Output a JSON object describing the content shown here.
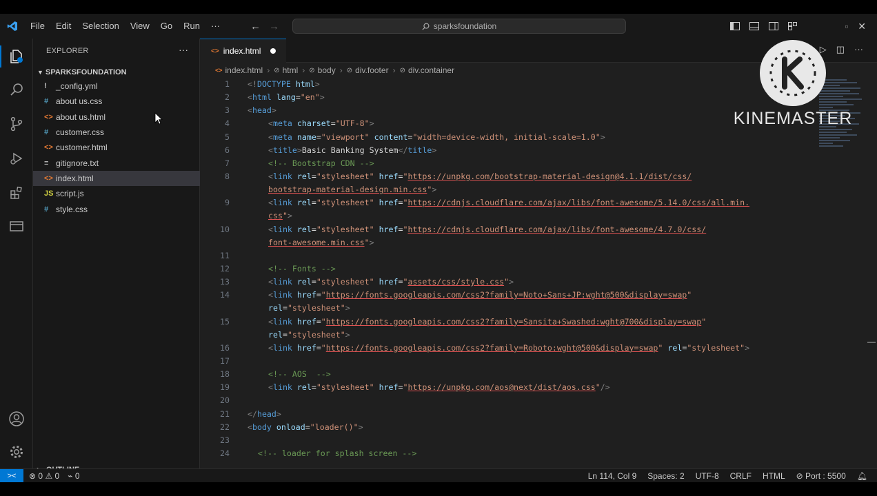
{
  "menu": [
    "File",
    "Edit",
    "Selection",
    "View",
    "Go",
    "Run",
    "···"
  ],
  "search": {
    "text": "sparksfoundation"
  },
  "sidebar": {
    "title": "EXPLORER",
    "more": "···",
    "folder": "SPARKSFOUNDATION",
    "files": [
      {
        "icon": "!",
        "name": "_config.yml",
        "color": "#c5c5c5"
      },
      {
        "icon": "#",
        "name": "about us.css",
        "color": "#519aba"
      },
      {
        "icon": "<>",
        "name": "about us.html",
        "color": "#e37933"
      },
      {
        "icon": "#",
        "name": "customer.css",
        "color": "#519aba"
      },
      {
        "icon": "<>",
        "name": "customer.html",
        "color": "#e37933"
      },
      {
        "icon": "≡",
        "name": "gitignore.txt",
        "color": "#c5c5c5"
      },
      {
        "icon": "<>",
        "name": "index.html",
        "color": "#e37933"
      },
      {
        "icon": "JS",
        "name": "script.js",
        "color": "#cbcb41"
      },
      {
        "icon": "#",
        "name": "style.css",
        "color": "#519aba"
      }
    ],
    "outline": "OUTLINE"
  },
  "tab": {
    "name": "index.html"
  },
  "breadcrumbs": [
    "index.html",
    "html",
    "body",
    "div.footer",
    "div.container"
  ],
  "code_lines": [
    {
      "n": "1",
      "i": 0,
      "s": [
        [
          "t",
          "<!"
        ],
        [
          "tn",
          "DOCTYPE"
        ],
        [
          "tx",
          " "
        ],
        [
          "an",
          "html"
        ],
        [
          "t",
          ">"
        ]
      ]
    },
    {
      "n": "2",
      "i": 0,
      "s": [
        [
          "t",
          "<"
        ],
        [
          "tn",
          "html"
        ],
        [
          "tx",
          " "
        ],
        [
          "an",
          "lang"
        ],
        [
          "tx",
          "="
        ],
        [
          "av",
          "\"en\""
        ],
        [
          "t",
          ">"
        ]
      ]
    },
    {
      "n": "3",
      "i": 0,
      "s": [
        [
          "t",
          "<"
        ],
        [
          "tn",
          "head"
        ],
        [
          "t",
          ">"
        ]
      ]
    },
    {
      "n": "4",
      "i": 2,
      "s": [
        [
          "t",
          "<"
        ],
        [
          "tn",
          "meta"
        ],
        [
          "tx",
          " "
        ],
        [
          "an",
          "charset"
        ],
        [
          "tx",
          "="
        ],
        [
          "av",
          "\"UTF-8\""
        ],
        [
          "t",
          ">"
        ]
      ]
    },
    {
      "n": "5",
      "i": 2,
      "s": [
        [
          "t",
          "<"
        ],
        [
          "tn",
          "meta"
        ],
        [
          "tx",
          " "
        ],
        [
          "an",
          "name"
        ],
        [
          "tx",
          "="
        ],
        [
          "av",
          "\"viewport\""
        ],
        [
          "tx",
          " "
        ],
        [
          "an",
          "content"
        ],
        [
          "tx",
          "="
        ],
        [
          "av",
          "\"width=device-width, initial-scale=1.0\""
        ],
        [
          "t",
          ">"
        ]
      ]
    },
    {
      "n": "6",
      "i": 2,
      "s": [
        [
          "t",
          "<"
        ],
        [
          "tn",
          "title"
        ],
        [
          "t",
          ">"
        ],
        [
          "tx",
          "Basic Banking System"
        ],
        [
          "t",
          "</"
        ],
        [
          "tn",
          "title"
        ],
        [
          "t",
          ">"
        ]
      ]
    },
    {
      "n": "7",
      "i": 2,
      "s": [
        [
          "cm",
          "<!-- Bootstrap CDN -->"
        ]
      ]
    },
    {
      "n": "8",
      "i": 2,
      "s": [
        [
          "t",
          "<"
        ],
        [
          "tn",
          "link"
        ],
        [
          "tx",
          " "
        ],
        [
          "an",
          "rel"
        ],
        [
          "tx",
          "="
        ],
        [
          "av",
          "\"stylesheet\""
        ],
        [
          "tx",
          " "
        ],
        [
          "an",
          "href"
        ],
        [
          "tx",
          "="
        ],
        [
          "av",
          "\""
        ],
        [
          "lnk",
          "https://unpkg.com/bootstrap-material-design@4.1.1/dist/css/"
        ]
      ]
    },
    {
      "n": "",
      "i": 2,
      "s": [
        [
          "lnk",
          "bootstrap-material-design.min.css"
        ],
        [
          "av",
          "\""
        ],
        [
          "t",
          ">"
        ]
      ]
    },
    {
      "n": "9",
      "i": 2,
      "s": [
        [
          "t",
          "<"
        ],
        [
          "tn",
          "link"
        ],
        [
          "tx",
          " "
        ],
        [
          "an",
          "rel"
        ],
        [
          "tx",
          "="
        ],
        [
          "av",
          "\"stylesheet\""
        ],
        [
          "tx",
          " "
        ],
        [
          "an",
          "href"
        ],
        [
          "tx",
          "="
        ],
        [
          "av",
          "\""
        ],
        [
          "lnk",
          "https://cdnjs.cloudflare.com/ajax/libs/font-awesome/5.14.0/css/all.min."
        ]
      ]
    },
    {
      "n": "",
      "i": 2,
      "s": [
        [
          "lnk",
          "css"
        ],
        [
          "av",
          "\""
        ],
        [
          "t",
          ">"
        ]
      ]
    },
    {
      "n": "10",
      "i": 2,
      "s": [
        [
          "t",
          "<"
        ],
        [
          "tn",
          "link"
        ],
        [
          "tx",
          " "
        ],
        [
          "an",
          "rel"
        ],
        [
          "tx",
          "="
        ],
        [
          "av",
          "\"stylesheet\""
        ],
        [
          "tx",
          " "
        ],
        [
          "an",
          "href"
        ],
        [
          "tx",
          "="
        ],
        [
          "av",
          "\""
        ],
        [
          "lnk",
          "https://cdnjs.cloudflare.com/ajax/libs/font-awesome/4.7.0/css/"
        ]
      ]
    },
    {
      "n": "",
      "i": 2,
      "s": [
        [
          "lnk",
          "font-awesome.min.css"
        ],
        [
          "av",
          "\""
        ],
        [
          "t",
          ">"
        ]
      ]
    },
    {
      "n": "11",
      "i": 0,
      "s": []
    },
    {
      "n": "12",
      "i": 2,
      "s": [
        [
          "cm",
          "<!-- Fonts -->"
        ]
      ]
    },
    {
      "n": "13",
      "i": 2,
      "s": [
        [
          "t",
          "<"
        ],
        [
          "tn",
          "link"
        ],
        [
          "tx",
          " "
        ],
        [
          "an",
          "rel"
        ],
        [
          "tx",
          "="
        ],
        [
          "av",
          "\"stylesheet\""
        ],
        [
          "tx",
          " "
        ],
        [
          "an",
          "href"
        ],
        [
          "tx",
          "="
        ],
        [
          "av",
          "\""
        ],
        [
          "lnk",
          "assets/css/style.css"
        ],
        [
          "av",
          "\""
        ],
        [
          "t",
          ">"
        ]
      ]
    },
    {
      "n": "14",
      "i": 2,
      "s": [
        [
          "t",
          "<"
        ],
        [
          "tn",
          "link"
        ],
        [
          "tx",
          " "
        ],
        [
          "an",
          "href"
        ],
        [
          "tx",
          "="
        ],
        [
          "av",
          "\""
        ],
        [
          "lnk",
          "https://fonts.googleapis.com/css2?family=Noto+Sans+JP:wght@500&display=swap"
        ],
        [
          "av",
          "\""
        ]
      ]
    },
    {
      "n": "",
      "i": 2,
      "s": [
        [
          "an",
          "rel"
        ],
        [
          "tx",
          "="
        ],
        [
          "av",
          "\"stylesheet\""
        ],
        [
          "t",
          ">"
        ]
      ]
    },
    {
      "n": "15",
      "i": 2,
      "s": [
        [
          "t",
          "<"
        ],
        [
          "tn",
          "link"
        ],
        [
          "tx",
          " "
        ],
        [
          "an",
          "href"
        ],
        [
          "tx",
          "="
        ],
        [
          "av",
          "\""
        ],
        [
          "lnk",
          "https://fonts.googleapis.com/css2?family=Sansita+Swashed:wght@700&display=swap"
        ],
        [
          "av",
          "\""
        ]
      ]
    },
    {
      "n": "",
      "i": 2,
      "s": [
        [
          "an",
          "rel"
        ],
        [
          "tx",
          "="
        ],
        [
          "av",
          "\"stylesheet\""
        ],
        [
          "t",
          ">"
        ]
      ]
    },
    {
      "n": "16",
      "i": 2,
      "s": [
        [
          "t",
          "<"
        ],
        [
          "tn",
          "link"
        ],
        [
          "tx",
          " "
        ],
        [
          "an",
          "href"
        ],
        [
          "tx",
          "="
        ],
        [
          "av",
          "\""
        ],
        [
          "lnk",
          "https://fonts.googleapis.com/css2?family=Roboto:wght@500&display=swap"
        ],
        [
          "av",
          "\""
        ],
        [
          "tx",
          " "
        ],
        [
          "an",
          "rel"
        ],
        [
          "tx",
          "="
        ],
        [
          "av",
          "\"stylesheet\""
        ],
        [
          "t",
          ">"
        ]
      ]
    },
    {
      "n": "17",
      "i": 0,
      "s": []
    },
    {
      "n": "18",
      "i": 2,
      "s": [
        [
          "cm",
          "<!-- AOS  -->"
        ]
      ]
    },
    {
      "n": "19",
      "i": 2,
      "s": [
        [
          "t",
          "<"
        ],
        [
          "tn",
          "link"
        ],
        [
          "tx",
          " "
        ],
        [
          "an",
          "rel"
        ],
        [
          "tx",
          "="
        ],
        [
          "av",
          "\"stylesheet\""
        ],
        [
          "tx",
          " "
        ],
        [
          "an",
          "href"
        ],
        [
          "tx",
          "="
        ],
        [
          "av",
          "\""
        ],
        [
          "lnk",
          "https://unpkg.com/aos@next/dist/aos.css"
        ],
        [
          "av",
          "\""
        ],
        [
          "t",
          "/>"
        ]
      ]
    },
    {
      "n": "20",
      "i": 0,
      "s": []
    },
    {
      "n": "21",
      "i": 0,
      "s": [
        [
          "t",
          "</"
        ],
        [
          "tn",
          "head"
        ],
        [
          "t",
          ">"
        ]
      ]
    },
    {
      "n": "22",
      "i": 0,
      "s": [
        [
          "t",
          "<"
        ],
        [
          "tn",
          "body"
        ],
        [
          "tx",
          " "
        ],
        [
          "an",
          "onload"
        ],
        [
          "tx",
          "="
        ],
        [
          "av",
          "\"loader()\""
        ],
        [
          "t",
          ">"
        ]
      ]
    },
    {
      "n": "23",
      "i": 0,
      "s": []
    },
    {
      "n": "24",
      "i": 1,
      "s": [
        [
          "cm",
          "<!-- loader for splash screen -->"
        ]
      ]
    }
  ],
  "status": {
    "errors": "0",
    "warnings": "0",
    "ports": "0",
    "position": "Ln 114, Col 9",
    "spaces": "Spaces: 2",
    "encoding": "UTF-8",
    "eol": "CRLF",
    "language": "HTML",
    "port": "Port : 5500"
  },
  "watermark": {
    "text": "KINEMASTER"
  },
  "colors": {
    "accent": "#0078d4",
    "background": "#1f1f1f",
    "sidebar": "#181818"
  }
}
